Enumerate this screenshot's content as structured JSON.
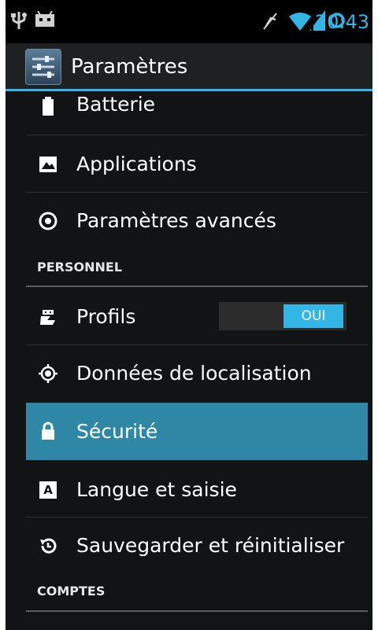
{
  "status_bar": {
    "time": "20:43",
    "left_icons": [
      "usb-icon",
      "android-debug-icon"
    ],
    "right_icons": [
      "mute-icon",
      "wifi-icon",
      "signal-icon",
      "sync-icon"
    ]
  },
  "action_bar": {
    "title": "Paramètres",
    "icon": "settings-app-icon",
    "accent_color": "#33b5e5"
  },
  "list": {
    "batterie": "Batterie",
    "applications": "Applications",
    "avances": "Paramètres avancés",
    "section_personnel": "PERSONNEL",
    "profils": "Profils",
    "profils_toggle": "OUI",
    "localisation": "Données de localisation",
    "securite": "Sécurité",
    "langue": "Langue et saisie",
    "sauvegarder": "Sauvegarder et réinitialiser",
    "section_comptes": "COMPTES"
  },
  "colors": {
    "highlight": "#2e87a5",
    "background": "#121315"
  }
}
